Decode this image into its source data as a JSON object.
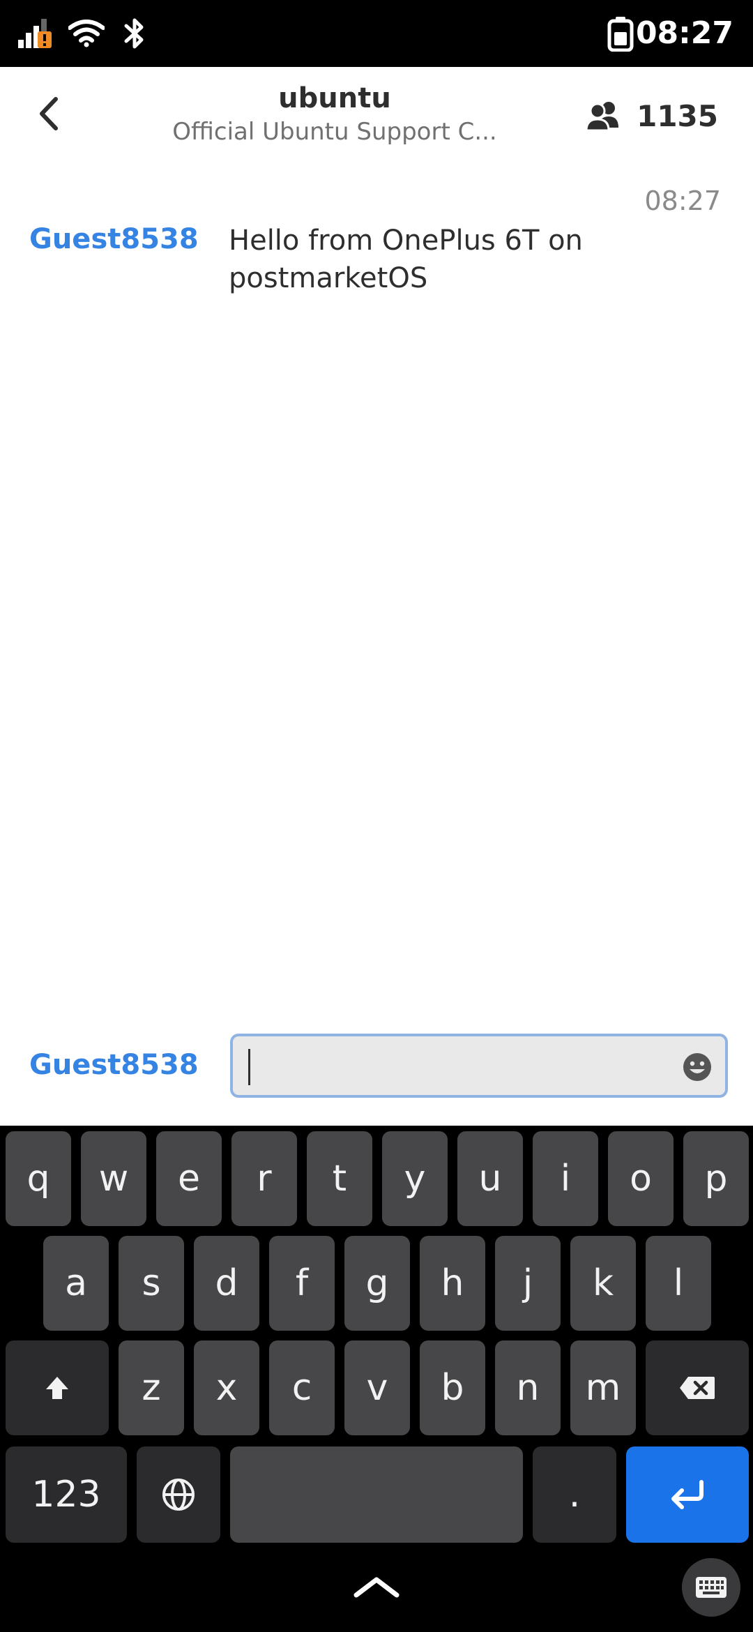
{
  "status_bar": {
    "time": "08:27",
    "icons": [
      "signal-icon",
      "wifi-icon",
      "bluetooth-icon",
      "battery-icon"
    ]
  },
  "header": {
    "title": "ubuntu",
    "subtitle": "Official Ubuntu Support C...",
    "member_count": "1135"
  },
  "messages": [
    {
      "time": "08:27",
      "user": "Guest8538",
      "text": "Hello from OnePlus 6T on postmarketOS"
    }
  ],
  "composer": {
    "nick": "Guest8538",
    "value": "",
    "placeholder": ""
  },
  "keyboard": {
    "row1": [
      "q",
      "w",
      "e",
      "r",
      "t",
      "y",
      "u",
      "i",
      "o",
      "p"
    ],
    "row2": [
      "a",
      "s",
      "d",
      "f",
      "g",
      "h",
      "j",
      "k",
      "l"
    ],
    "row3": [
      "z",
      "x",
      "c",
      "v",
      "b",
      "n",
      "m"
    ],
    "numbers_label": "123",
    "period_label": "."
  },
  "colors": {
    "accent": "#3584e4",
    "enter_key": "#1a73e8",
    "key": "#47474a",
    "key_dark": "#2b2b2d"
  }
}
